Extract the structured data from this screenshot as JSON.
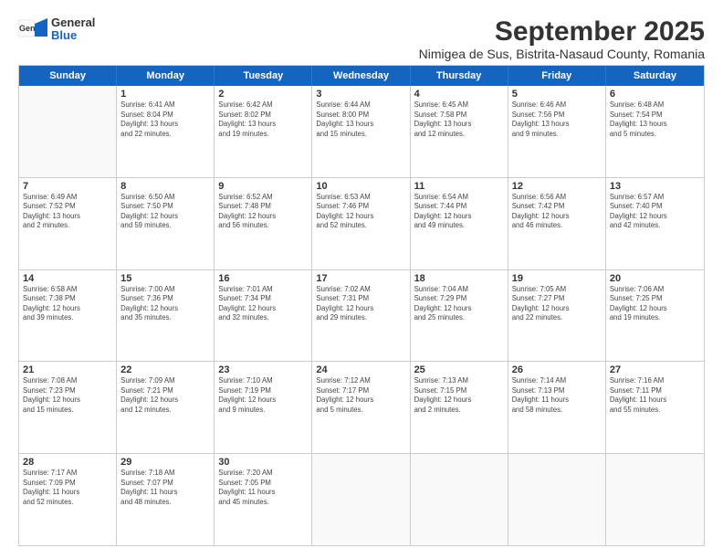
{
  "logo": {
    "general": "General",
    "blue": "Blue"
  },
  "title": "September 2025",
  "subtitle": "Nimigea de Sus, Bistrita-Nasaud County, Romania",
  "header_days": [
    "Sunday",
    "Monday",
    "Tuesday",
    "Wednesday",
    "Thursday",
    "Friday",
    "Saturday"
  ],
  "weeks": [
    [
      {
        "day": "",
        "text": ""
      },
      {
        "day": "1",
        "text": "Sunrise: 6:41 AM\nSunset: 8:04 PM\nDaylight: 13 hours\nand 22 minutes."
      },
      {
        "day": "2",
        "text": "Sunrise: 6:42 AM\nSunset: 8:02 PM\nDaylight: 13 hours\nand 19 minutes."
      },
      {
        "day": "3",
        "text": "Sunrise: 6:44 AM\nSunset: 8:00 PM\nDaylight: 13 hours\nand 15 minutes."
      },
      {
        "day": "4",
        "text": "Sunrise: 6:45 AM\nSunset: 7:58 PM\nDaylight: 13 hours\nand 12 minutes."
      },
      {
        "day": "5",
        "text": "Sunrise: 6:46 AM\nSunset: 7:56 PM\nDaylight: 13 hours\nand 9 minutes."
      },
      {
        "day": "6",
        "text": "Sunrise: 6:48 AM\nSunset: 7:54 PM\nDaylight: 13 hours\nand 5 minutes."
      }
    ],
    [
      {
        "day": "7",
        "text": "Sunrise: 6:49 AM\nSunset: 7:52 PM\nDaylight: 13 hours\nand 2 minutes."
      },
      {
        "day": "8",
        "text": "Sunrise: 6:50 AM\nSunset: 7:50 PM\nDaylight: 12 hours\nand 59 minutes."
      },
      {
        "day": "9",
        "text": "Sunrise: 6:52 AM\nSunset: 7:48 PM\nDaylight: 12 hours\nand 56 minutes."
      },
      {
        "day": "10",
        "text": "Sunrise: 6:53 AM\nSunset: 7:46 PM\nDaylight: 12 hours\nand 52 minutes."
      },
      {
        "day": "11",
        "text": "Sunrise: 6:54 AM\nSunset: 7:44 PM\nDaylight: 12 hours\nand 49 minutes."
      },
      {
        "day": "12",
        "text": "Sunrise: 6:56 AM\nSunset: 7:42 PM\nDaylight: 12 hours\nand 46 minutes."
      },
      {
        "day": "13",
        "text": "Sunrise: 6:57 AM\nSunset: 7:40 PM\nDaylight: 12 hours\nand 42 minutes."
      }
    ],
    [
      {
        "day": "14",
        "text": "Sunrise: 6:58 AM\nSunset: 7:38 PM\nDaylight: 12 hours\nand 39 minutes."
      },
      {
        "day": "15",
        "text": "Sunrise: 7:00 AM\nSunset: 7:36 PM\nDaylight: 12 hours\nand 35 minutes."
      },
      {
        "day": "16",
        "text": "Sunrise: 7:01 AM\nSunset: 7:34 PM\nDaylight: 12 hours\nand 32 minutes."
      },
      {
        "day": "17",
        "text": "Sunrise: 7:02 AM\nSunset: 7:31 PM\nDaylight: 12 hours\nand 29 minutes."
      },
      {
        "day": "18",
        "text": "Sunrise: 7:04 AM\nSunset: 7:29 PM\nDaylight: 12 hours\nand 25 minutes."
      },
      {
        "day": "19",
        "text": "Sunrise: 7:05 AM\nSunset: 7:27 PM\nDaylight: 12 hours\nand 22 minutes."
      },
      {
        "day": "20",
        "text": "Sunrise: 7:06 AM\nSunset: 7:25 PM\nDaylight: 12 hours\nand 19 minutes."
      }
    ],
    [
      {
        "day": "21",
        "text": "Sunrise: 7:08 AM\nSunset: 7:23 PM\nDaylight: 12 hours\nand 15 minutes."
      },
      {
        "day": "22",
        "text": "Sunrise: 7:09 AM\nSunset: 7:21 PM\nDaylight: 12 hours\nand 12 minutes."
      },
      {
        "day": "23",
        "text": "Sunrise: 7:10 AM\nSunset: 7:19 PM\nDaylight: 12 hours\nand 9 minutes."
      },
      {
        "day": "24",
        "text": "Sunrise: 7:12 AM\nSunset: 7:17 PM\nDaylight: 12 hours\nand 5 minutes."
      },
      {
        "day": "25",
        "text": "Sunrise: 7:13 AM\nSunset: 7:15 PM\nDaylight: 12 hours\nand 2 minutes."
      },
      {
        "day": "26",
        "text": "Sunrise: 7:14 AM\nSunset: 7:13 PM\nDaylight: 11 hours\nand 58 minutes."
      },
      {
        "day": "27",
        "text": "Sunrise: 7:16 AM\nSunset: 7:11 PM\nDaylight: 11 hours\nand 55 minutes."
      }
    ],
    [
      {
        "day": "28",
        "text": "Sunrise: 7:17 AM\nSunset: 7:09 PM\nDaylight: 11 hours\nand 52 minutes."
      },
      {
        "day": "29",
        "text": "Sunrise: 7:18 AM\nSunset: 7:07 PM\nDaylight: 11 hours\nand 48 minutes."
      },
      {
        "day": "30",
        "text": "Sunrise: 7:20 AM\nSunset: 7:05 PM\nDaylight: 11 hours\nand 45 minutes."
      },
      {
        "day": "",
        "text": ""
      },
      {
        "day": "",
        "text": ""
      },
      {
        "day": "",
        "text": ""
      },
      {
        "day": "",
        "text": ""
      }
    ]
  ]
}
